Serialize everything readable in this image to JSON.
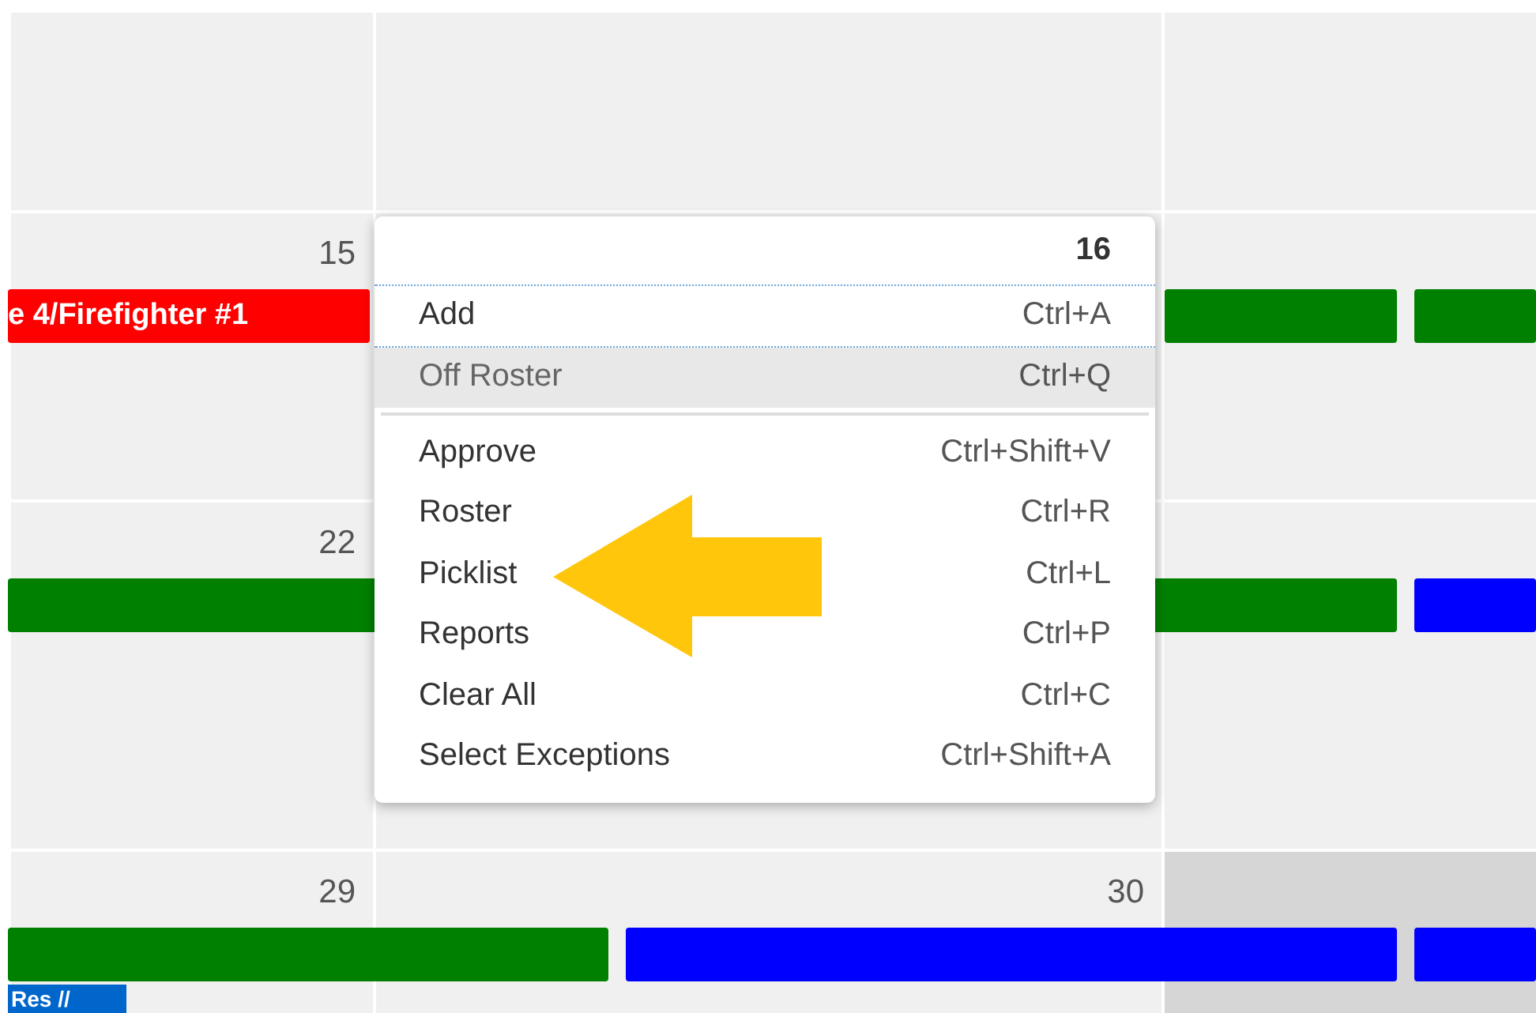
{
  "calendar": {
    "weeks": [
      {
        "cells": [
          {
            "shaded": false
          },
          {
            "shaded": false
          },
          {
            "shaded": false
          }
        ]
      },
      {
        "cells": [
          {
            "day": "15",
            "shaded": false
          },
          {
            "shaded": false
          },
          {
            "shaded": false
          }
        ],
        "events": [
          {
            "color": "#ff0000",
            "label": "e 4/Firefighter #1"
          },
          {
            "color": "#008000"
          },
          {
            "color": "#008000"
          }
        ]
      },
      {
        "cells": [
          {
            "day": "22",
            "shaded": false
          },
          {
            "shaded": false
          },
          {
            "shaded": false
          }
        ],
        "events": [
          {
            "color": "#008000"
          },
          {
            "color": "#0000ff"
          }
        ]
      },
      {
        "cells": [
          {
            "day": "29",
            "shaded": false
          },
          {
            "day": "30",
            "shaded": false
          },
          {
            "shaded": true
          }
        ],
        "events": [
          {
            "color": "#008000"
          },
          {
            "color": "#0000ff"
          },
          {
            "color": "#0000ff"
          }
        ],
        "tag": "Res //"
      }
    ]
  },
  "context_menu": {
    "header": "16",
    "items": [
      {
        "label": "Add",
        "shortcut": "Ctrl+A",
        "focused": true,
        "highlighted": false,
        "disabled": false,
        "separator_after": false
      },
      {
        "label": "Off Roster",
        "shortcut": "Ctrl+Q",
        "focused": false,
        "highlighted": true,
        "disabled": true,
        "separator_after": true
      },
      {
        "label": "Approve",
        "shortcut": "Ctrl+Shift+V",
        "focused": false,
        "highlighted": false,
        "disabled": false,
        "separator_after": false
      },
      {
        "label": "Roster",
        "shortcut": "Ctrl+R",
        "focused": false,
        "highlighted": false,
        "disabled": false,
        "separator_after": false
      },
      {
        "label": "Picklist",
        "shortcut": "Ctrl+L",
        "focused": false,
        "highlighted": false,
        "disabled": false,
        "separator_after": false
      },
      {
        "label": "Reports",
        "shortcut": "Ctrl+P",
        "focused": false,
        "highlighted": false,
        "disabled": false,
        "separator_after": false
      },
      {
        "label": "Clear All",
        "shortcut": "Ctrl+C",
        "focused": false,
        "highlighted": false,
        "disabled": false,
        "separator_after": false
      },
      {
        "label": "Select Exceptions",
        "shortcut": "Ctrl+Shift+A",
        "focused": false,
        "highlighted": false,
        "disabled": false,
        "separator_after": false
      }
    ]
  }
}
